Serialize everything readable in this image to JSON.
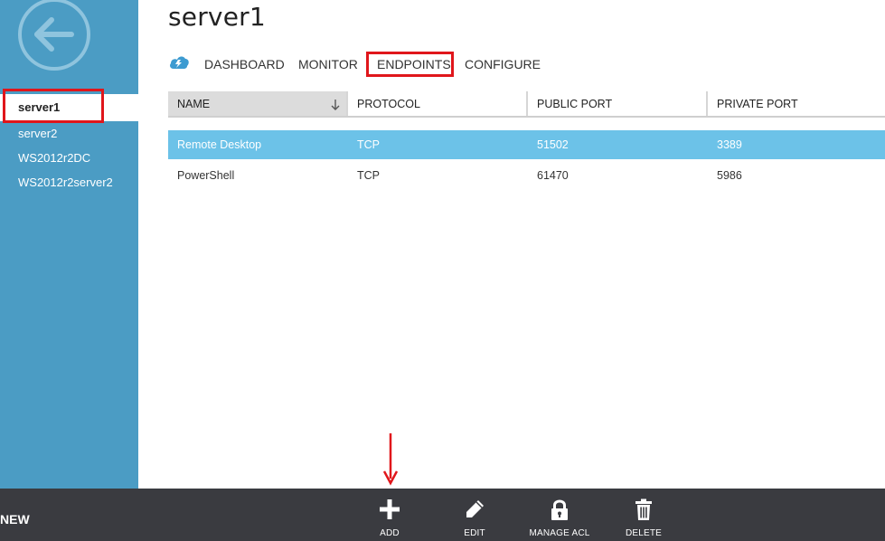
{
  "page": {
    "title": "server1"
  },
  "sidebar": {
    "items": [
      {
        "label": "server1",
        "selected": true
      },
      {
        "label": "server2",
        "selected": false
      },
      {
        "label": "WS2012r2DC",
        "selected": false
      },
      {
        "label": "WS2012r2server2",
        "selected": false
      }
    ]
  },
  "tabs": [
    {
      "label": "DASHBOARD"
    },
    {
      "label": "MONITOR"
    },
    {
      "label": "ENDPOINTS",
      "active": true
    },
    {
      "label": "CONFIGURE"
    }
  ],
  "table": {
    "columns": [
      "NAME",
      "PROTOCOL",
      "PUBLIC PORT",
      "PRIVATE PORT"
    ],
    "sorted_column": "NAME",
    "rows": [
      {
        "name": "Remote Desktop",
        "protocol": "TCP",
        "public_port": "51502",
        "private_port": "3389",
        "selected": true
      },
      {
        "name": "PowerShell",
        "protocol": "TCP",
        "public_port": "61470",
        "private_port": "5986",
        "selected": false
      }
    ]
  },
  "command_bar": {
    "new_label": "NEW",
    "commands": [
      {
        "label": "ADD",
        "icon": "plus-icon"
      },
      {
        "label": "EDIT",
        "icon": "pencil-icon"
      },
      {
        "label": "MANAGE ACL",
        "icon": "lock-icon"
      },
      {
        "label": "DELETE",
        "icon": "trash-icon"
      }
    ]
  },
  "colors": {
    "sidebar": "#4b9cc4",
    "selected_row": "#6cc2e8",
    "command_bar": "#3a3b40",
    "annotation": "#e0161b"
  }
}
